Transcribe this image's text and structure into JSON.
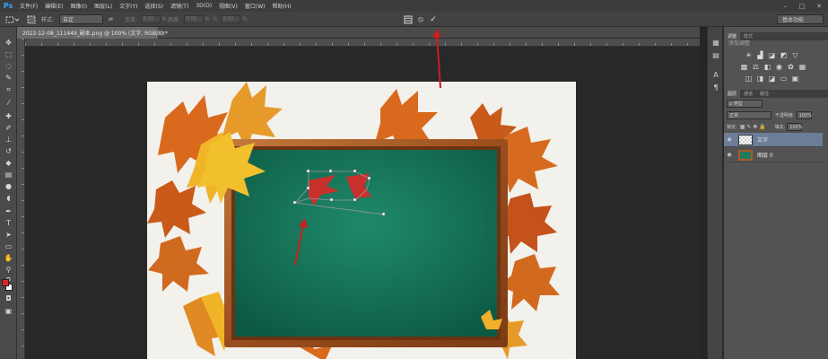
{
  "app": {
    "logo": "Ps",
    "menu": [
      "文件(F)",
      "编辑(E)",
      "图像(I)",
      "图层(L)",
      "文字(Y)",
      "选择(S)",
      "滤镜(T)",
      "3D(D)",
      "视图(V)",
      "窗口(W)",
      "帮助(H)"
    ],
    "window_controls": [
      "–",
      "□",
      "✕"
    ]
  },
  "options_bar": {
    "style_label": "样式:",
    "style_value": "自定",
    "width_label": "宽度:",
    "height_label": "高度:",
    "h_label": "H:",
    "v_label": "V:",
    "pct": "%",
    "unit_field": "0.00",
    "confirm_symbol": "✓",
    "cancel_symbol": "⦸",
    "workspace": "基本功能"
  },
  "document": {
    "tab_title": "2022-12-08_111449_副本.png @ 100% (文字, RGB/8) *",
    "close": "×",
    "colors": {
      "foreground": "#e8212a",
      "background": "#ffffff",
      "board": "#16755a",
      "frame": "#a65a28",
      "text_red": "#c8302c"
    }
  },
  "panels": {
    "top_tabs": [
      "调整",
      "样式"
    ],
    "adjust_title": "添加调整",
    "layers_tabs": [
      "图层",
      "通道",
      "路径"
    ],
    "filter_label": "ρ 类型",
    "blend_mode": "正常",
    "opacity_label": "不透明度:",
    "opacity_value": "100%",
    "lock_label": "锁定:",
    "fill_label": "填充:",
    "fill_value": "100%",
    "layers": [
      {
        "name": "文字",
        "selected": true
      },
      {
        "name": "图层 0",
        "selected": false
      }
    ]
  }
}
